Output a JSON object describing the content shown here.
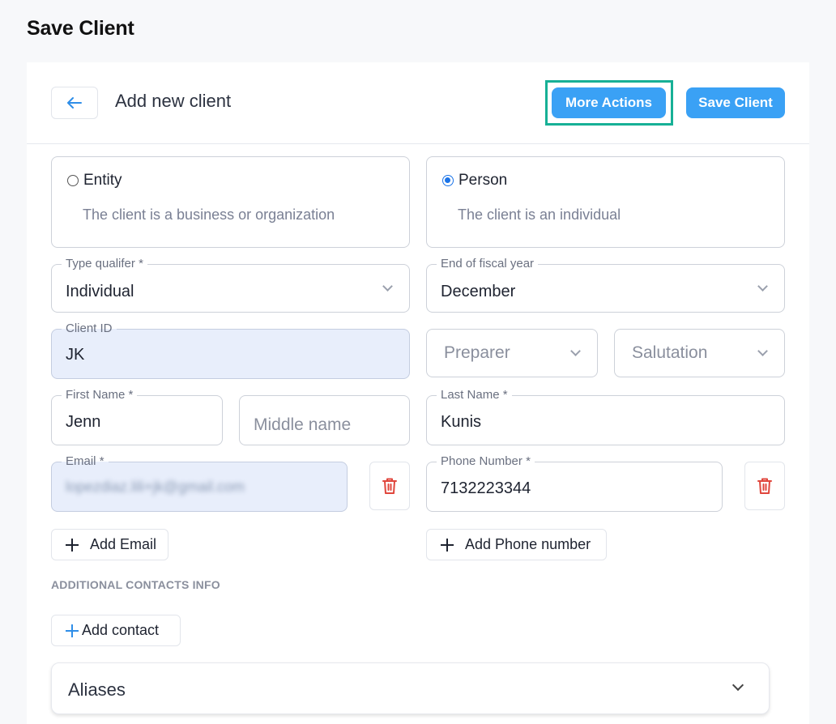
{
  "page": {
    "title": "Save Client"
  },
  "header": {
    "title": "Add new client",
    "more_actions": "More Actions",
    "save_client": "Save Client"
  },
  "client_type": {
    "entity": {
      "label": "Entity",
      "description": "The client is a business or organization",
      "selected": false
    },
    "person": {
      "label": "Person",
      "description": "The client is an individual",
      "selected": true
    }
  },
  "fields": {
    "type_qualifier": {
      "label": "Type qualifer",
      "required": "*",
      "value": "Individual"
    },
    "fiscal_year_end": {
      "label": "End of fiscal year",
      "value": "December"
    },
    "client_id": {
      "label": "Client ID",
      "value": "JK"
    },
    "preparer": {
      "placeholder": "Preparer"
    },
    "salutation": {
      "placeholder": "Salutation"
    },
    "first_name": {
      "label": "First Name",
      "required": "*",
      "value": "Jenn"
    },
    "middle_name": {
      "placeholder": "Middle name"
    },
    "last_name": {
      "label": "Last Name",
      "required": "*",
      "value": "Kunis"
    },
    "email": {
      "label": "Email",
      "required": "*",
      "value": "lopezdiaz.lili+jk@gmail.com"
    },
    "phone": {
      "label": "Phone Number",
      "required": "*",
      "value": "7132223344"
    }
  },
  "actions": {
    "add_email": "Add Email",
    "add_phone": "Add Phone number",
    "add_contact": "Add contact"
  },
  "sections": {
    "additional_contacts": "ADDITIONAL CONTACTS INFO",
    "aliases": "Aliases"
  },
  "colors": {
    "primary": "#3aa1f5",
    "highlight": "#17b096",
    "filled_field": "#e8eefb",
    "delete": "#e0463c"
  }
}
